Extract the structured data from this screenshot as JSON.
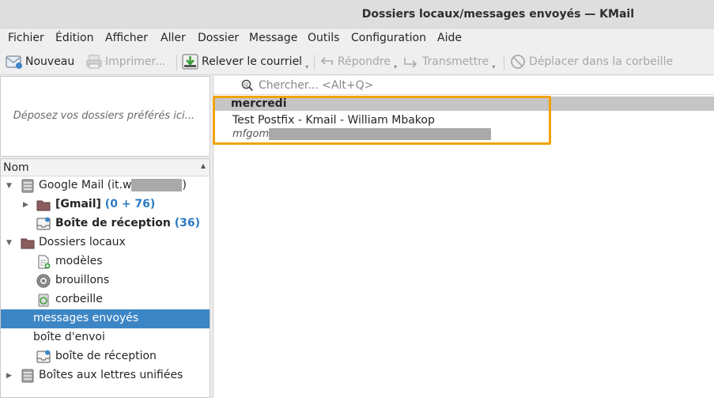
{
  "window": {
    "title": "Dossiers locaux/messages envoyés — KMail"
  },
  "menu": [
    "Fichier",
    "Édition",
    "Afficher",
    "Aller",
    "Dossier",
    "Message",
    "Outils",
    "Configuration",
    "Aide"
  ],
  "toolbar": {
    "new_label": "Nouveau",
    "print_label": "Imprimer...",
    "fetch_label": "Relever le courriel",
    "reply_label": "Répondre",
    "forward_label": "Transmettre",
    "trash_label": "Déplacer dans la corbeille"
  },
  "favorites": {
    "placeholder": "Déposez vos dossiers préférés ici..."
  },
  "folder_tree": {
    "header": "Nom",
    "items": [
      {
        "label": "Google Mail (it.w",
        "suffix": ")"
      },
      {
        "label": "[Gmail]",
        "count": "(0 + 76)"
      },
      {
        "label": "Boîte de réception",
        "count": "(36)"
      },
      {
        "label": "Dossiers locaux"
      },
      {
        "label": "modèles"
      },
      {
        "label": "brouillons"
      },
      {
        "label": "corbeille"
      },
      {
        "label": "messages envoyés"
      },
      {
        "label": "boîte d'envoi"
      },
      {
        "label": "boîte de réception"
      },
      {
        "label": "Boîtes aux lettres unifiées"
      }
    ]
  },
  "search": {
    "placeholder": "Chercher... <Alt+Q>"
  },
  "message_list": {
    "group_label": "mercredi",
    "messages": [
      {
        "subject": "Test Postfix - Kmail - William Mbakop",
        "sender": "mfgom"
      }
    ]
  },
  "colors": {
    "selection": "#3d86c6",
    "highlight": "#f0a30a",
    "count": "#2b7ac2"
  }
}
